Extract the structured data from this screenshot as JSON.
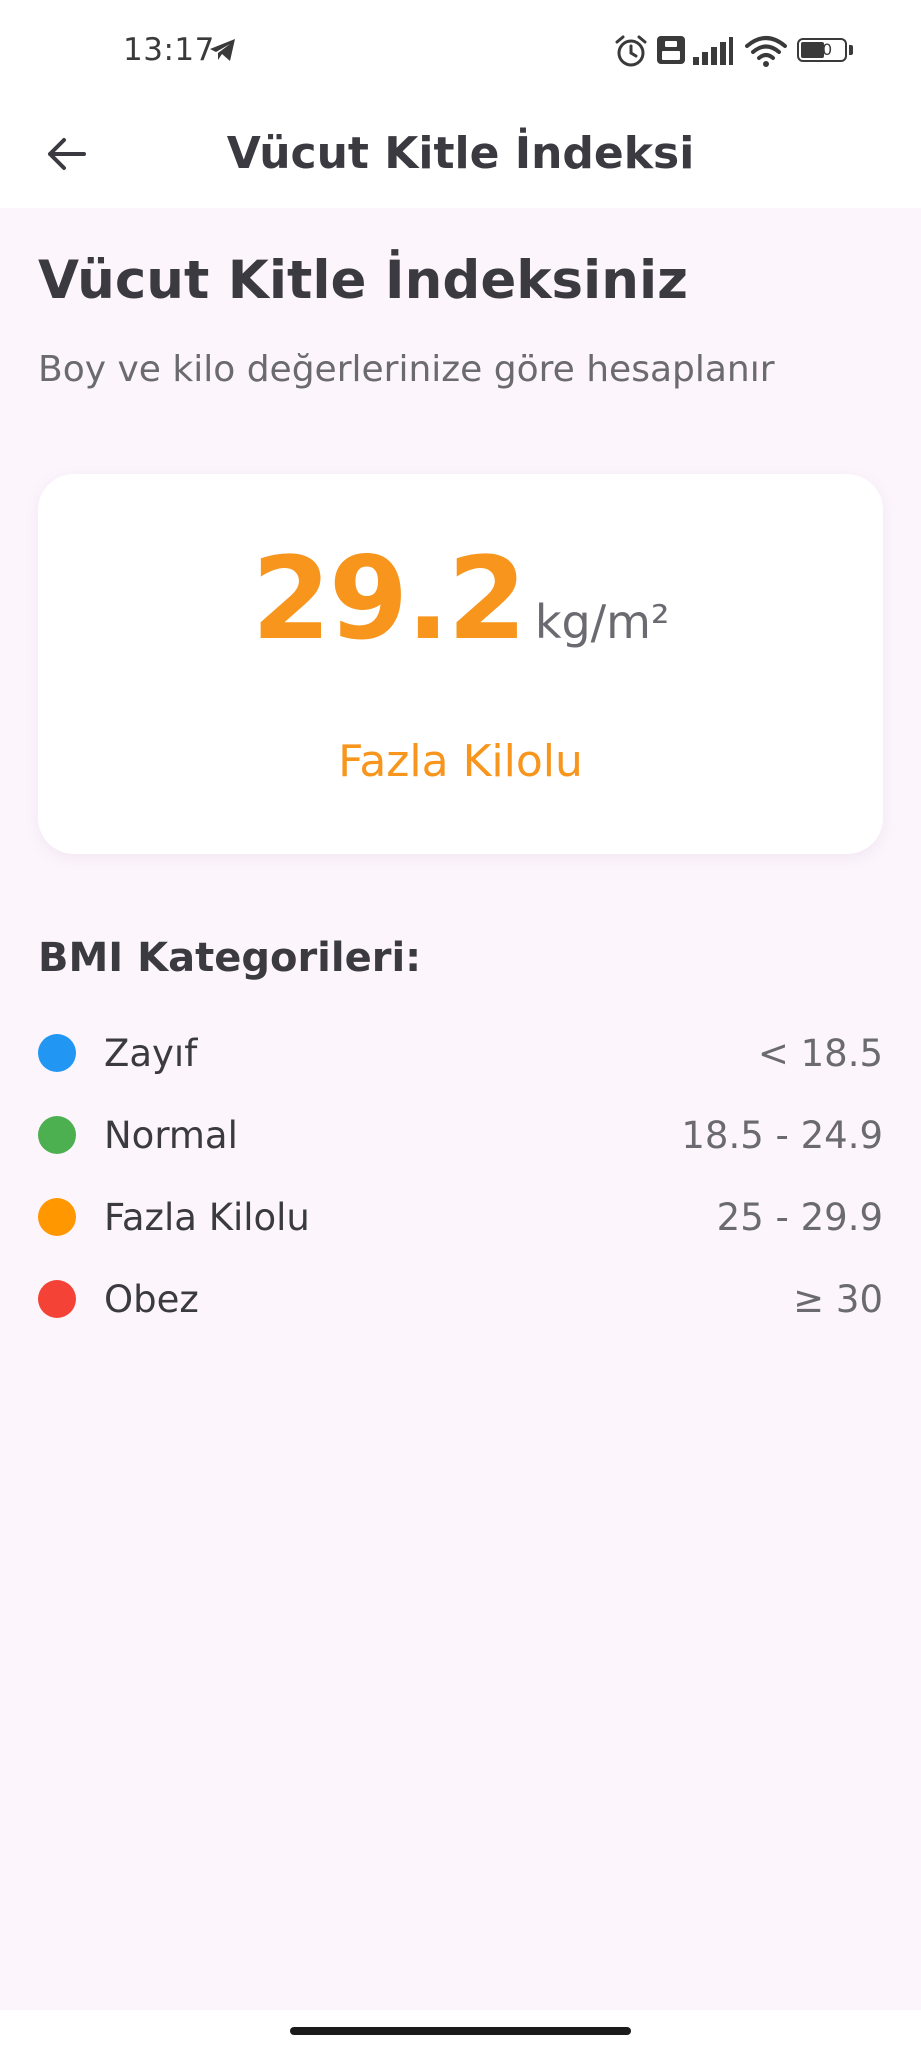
{
  "status_bar": {
    "time": "13:17",
    "battery_level": "50",
    "icons": [
      "telegram-icon",
      "alarm-icon",
      "volte-icon",
      "signal-icon",
      "wifi-icon",
      "battery-icon"
    ]
  },
  "app_bar": {
    "title": "Vücut Kitle İndeksi",
    "back_icon": "arrow-left-icon"
  },
  "main": {
    "heading": "Vücut Kitle İndeksiniz",
    "subheading": "Boy ve kilo değerlerinize göre hesaplanır",
    "result": {
      "value": "29.2",
      "unit": "kg/m²",
      "category": "Fazla Kilolu",
      "accent_color": "#f7951d"
    },
    "categories_title": "BMI Kategorileri:",
    "categories": [
      {
        "name": "Zayıf",
        "range": "< 18.5",
        "color": "#2196f3"
      },
      {
        "name": "Normal",
        "range": "18.5 - 24.9",
        "color": "#4caf50"
      },
      {
        "name": "Fazla Kilolu",
        "range": "25 - 29.9",
        "color": "#ff9800"
      },
      {
        "name": "Obez",
        "range": "≥ 30",
        "color": "#f44336"
      }
    ]
  },
  "colors": {
    "background": "#fcf5fc",
    "surface": "#ffffff",
    "text_primary": "#3b3a40",
    "text_secondary": "#6b6a70"
  }
}
